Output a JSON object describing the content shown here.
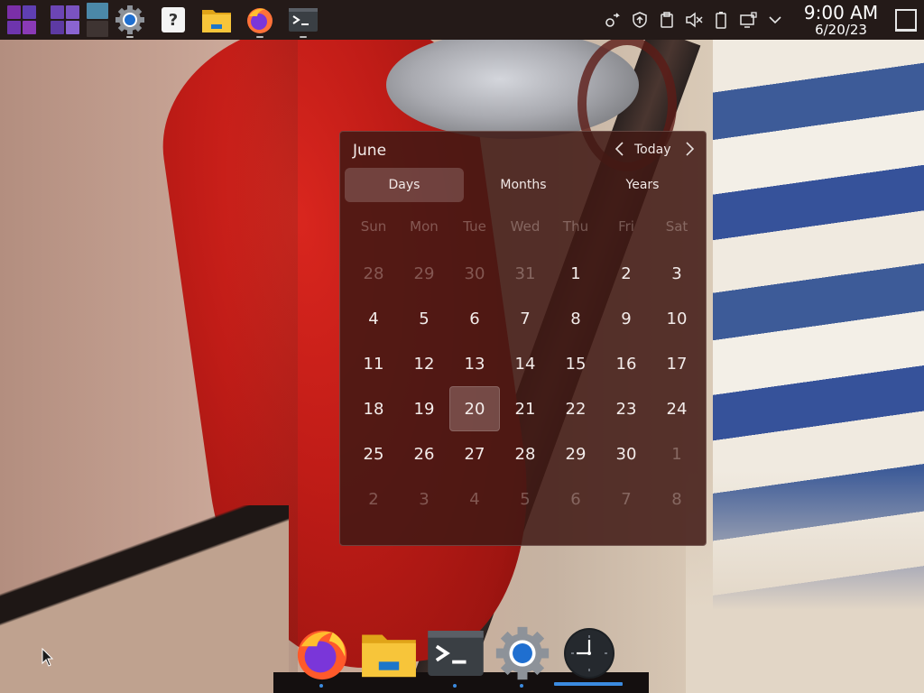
{
  "top_panel": {
    "launchers": [
      "app-grid-icon",
      "activities-icon",
      "virtual-desktop-pager-icon",
      "system-settings-icon",
      "help-icon",
      "file-manager-icon",
      "firefox-icon",
      "terminal-icon"
    ],
    "help_glyph": "?",
    "tray_icons": [
      "kde-connect-icon",
      "update-notifier-icon",
      "clipboard-icon",
      "volume-muted-icon",
      "battery-icon",
      "network-icon",
      "expand-tray-icon"
    ],
    "clock": {
      "time": "9:00 AM",
      "date": "6/20/23"
    },
    "show_desktop": "show-desktop-icon"
  },
  "calendar": {
    "month": "June",
    "today_label": "Today",
    "tabs": [
      {
        "label": "Days",
        "active": true
      },
      {
        "label": "Months",
        "active": false
      },
      {
        "label": "Years",
        "active": false
      }
    ],
    "weekdays": [
      "Sun",
      "Mon",
      "Tue",
      "Wed",
      "Thu",
      "Fri",
      "Sat"
    ],
    "weeks": [
      [
        "28",
        "29",
        "30",
        "31",
        "1",
        "2",
        "3"
      ],
      [
        "4",
        "5",
        "6",
        "7",
        "8",
        "9",
        "10"
      ],
      [
        "11",
        "12",
        "13",
        "14",
        "15",
        "16",
        "17"
      ],
      [
        "18",
        "19",
        "20",
        "21",
        "22",
        "23",
        "24"
      ],
      [
        "25",
        "26",
        "27",
        "28",
        "29",
        "30",
        "1"
      ],
      [
        "2",
        "3",
        "4",
        "5",
        "6",
        "7",
        "8"
      ]
    ],
    "selected_day": "20"
  },
  "dock": {
    "items": [
      "firefox-icon",
      "file-manager-icon",
      "terminal-icon",
      "system-settings-icon",
      "clock-icon"
    ],
    "active_item": "clock-icon"
  },
  "colors": {
    "panel_bg": "#241a18",
    "calendar_bg": "#401814",
    "dock_indicator": "#3b8be0"
  }
}
